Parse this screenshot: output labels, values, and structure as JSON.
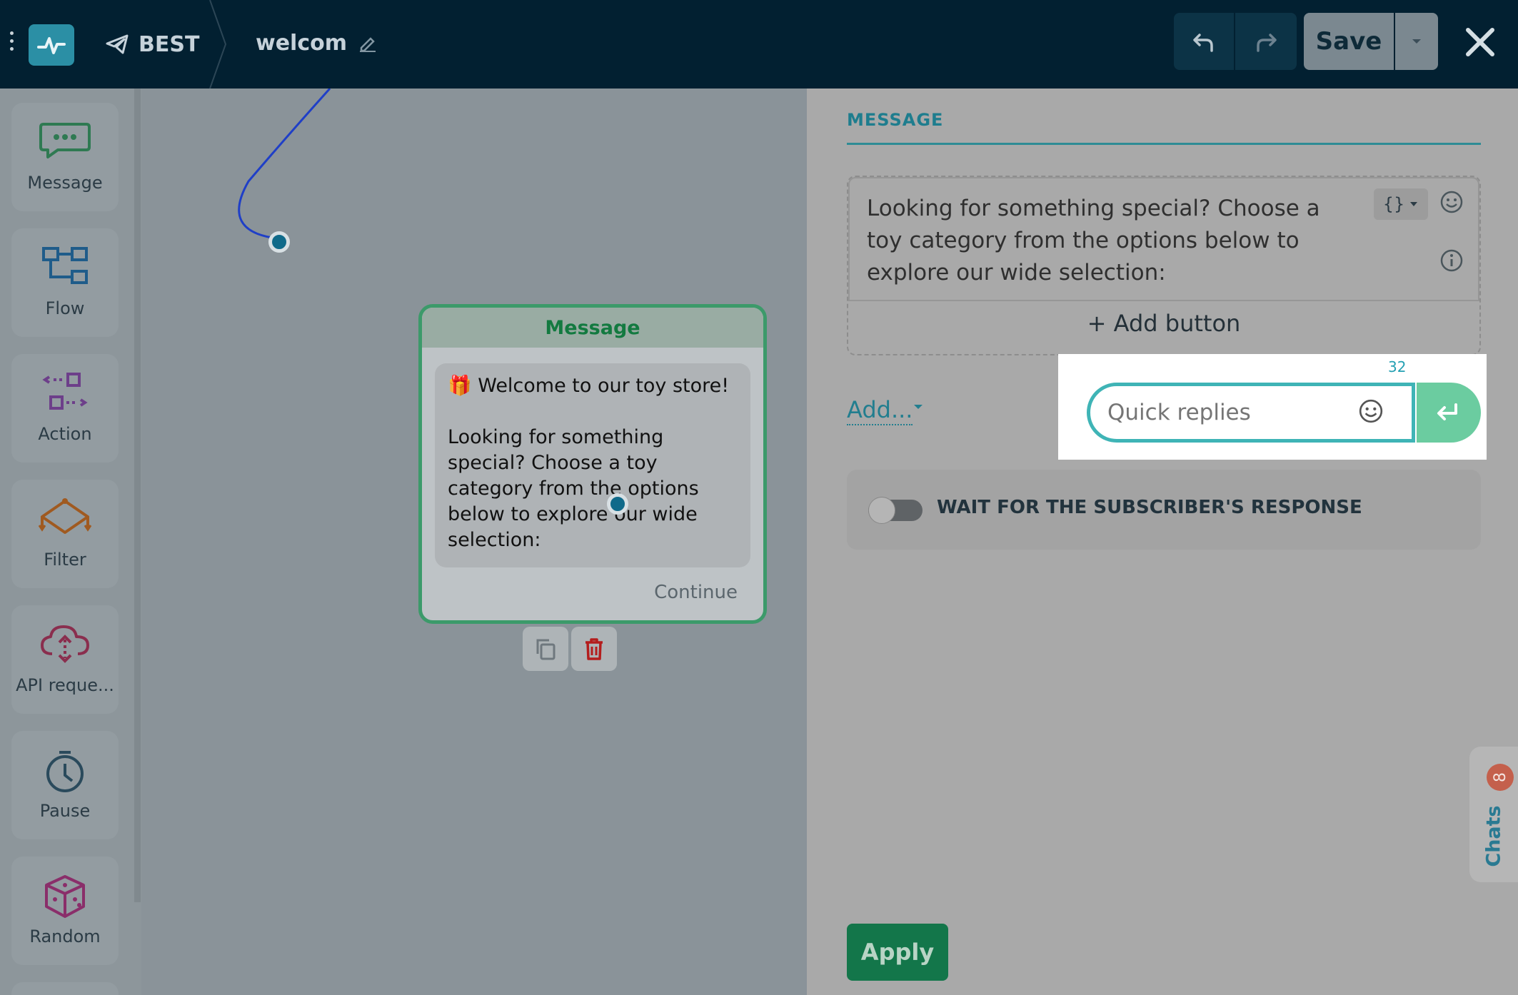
{
  "header": {
    "bot_name": "BEST",
    "flow_name": "welcom",
    "save_label": "Save"
  },
  "toolbox": {
    "items": [
      {
        "label": "Message",
        "icon": "message-bubble-icon",
        "color": "#2f7a52"
      },
      {
        "label": "Flow",
        "icon": "flow-icon",
        "color": "#1f5c8a"
      },
      {
        "label": "Action",
        "icon": "action-icon",
        "color": "#6d3f8a"
      },
      {
        "label": "Filter",
        "icon": "filter-icon",
        "color": "#a05a20"
      },
      {
        "label": "API reque...",
        "icon": "api-cloud-icon",
        "color": "#8a2e4e"
      },
      {
        "label": "Pause",
        "icon": "timer-icon",
        "color": "#2a4a5c"
      },
      {
        "label": "Random",
        "icon": "dice-icon",
        "color": "#8a2e6a"
      }
    ]
  },
  "canvas": {
    "node": {
      "title": "Message",
      "text": "🎁 Welcome to our toy store!\n\nLooking for something special? Choose a toy category from the options below to explore our wide selection:",
      "continue_label": "Continue"
    }
  },
  "panel": {
    "title": "MESSAGE",
    "message_text": "Looking for something special? Choose a toy category from the options below to explore our wide selection:",
    "add_button_label": "+ Add button",
    "add_menu_label": "Add...",
    "quick_replies": {
      "placeholder": "Quick replies",
      "char_counter": "32"
    },
    "wait_label": "WAIT FOR THE SUBSCRIBER'S RESPONSE",
    "wait_enabled": false,
    "apply_label": "Apply"
  },
  "chats": {
    "label": "Chats",
    "badge": "8"
  }
}
